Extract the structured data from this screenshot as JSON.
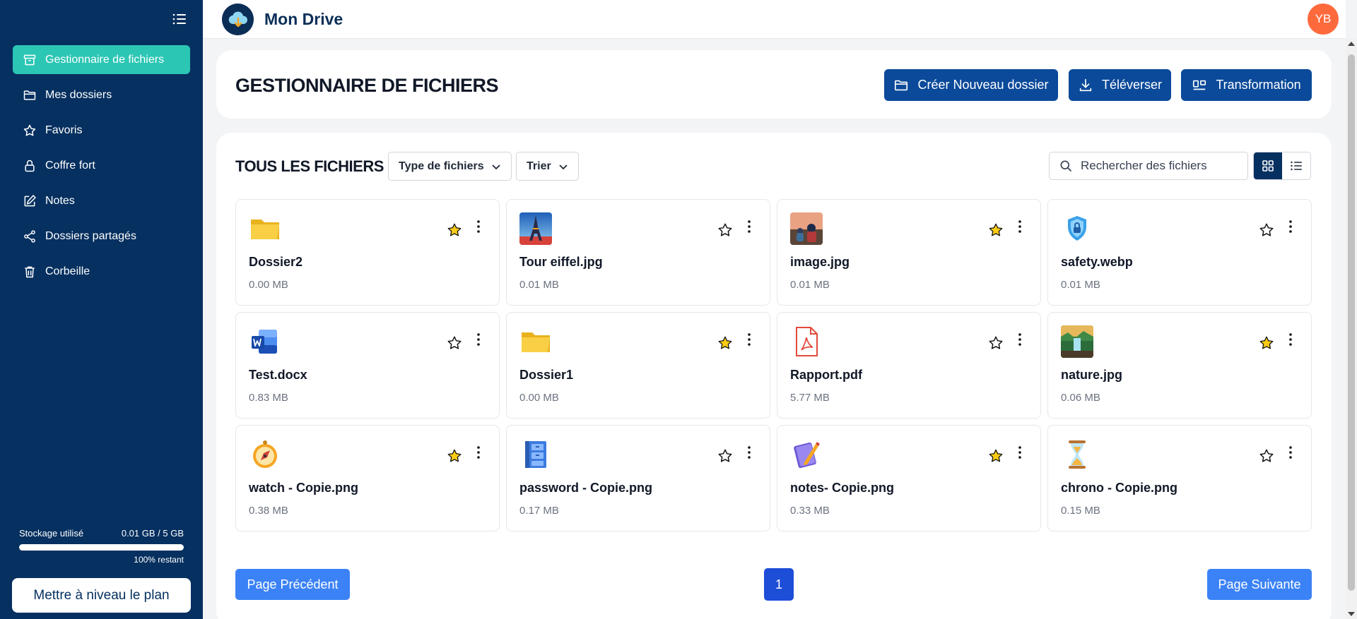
{
  "app": {
    "title": "Mon Drive",
    "avatar_initials": "YB"
  },
  "colors": {
    "sidebar_bg": "#063060",
    "active_item": "#2cc6b4",
    "primary_button": "#0b4a9a",
    "pager_button": "#3b82f6",
    "avatar": "#ff6a3d",
    "star_filled": "#facc15"
  },
  "sidebar": {
    "items": [
      {
        "label": "Gestionnaire de fichiers",
        "icon": "archive-icon",
        "active": true
      },
      {
        "label": "Mes dossiers",
        "icon": "folder-icon"
      },
      {
        "label": "Favoris",
        "icon": "star-icon"
      },
      {
        "label": "Coffre fort",
        "icon": "lock-icon"
      },
      {
        "label": "Notes",
        "icon": "edit-icon"
      },
      {
        "label": "Dossiers partagés",
        "icon": "share-icon"
      },
      {
        "label": "Corbeille",
        "icon": "trash-icon"
      }
    ],
    "storage": {
      "label": "Stockage utilisé",
      "value": "0.01 GB / 5 GB",
      "remaining": "100% restant",
      "used_fraction": 1.0
    },
    "upgrade_label": "Mettre à niveau le plan"
  },
  "header": {
    "title": "GESTIONNAIRE DE FICHIERS",
    "buttons": {
      "new_folder": "Créer Nouveau dossier",
      "upload": "Téléverser",
      "transform": "Transformation"
    }
  },
  "main": {
    "title": "TOUS LES FICHIERS",
    "filter_label": "Type de fichiers",
    "sort_label": "Trier",
    "search_placeholder": "Rechercher des fichiers",
    "files": [
      {
        "name": "Dossier2",
        "size": "0.00 MB",
        "icon": "folder-icon",
        "starred": true
      },
      {
        "name": "Tour eiffel.jpg",
        "size": "0.01 MB",
        "icon": "eiffel-image-icon",
        "starred": false
      },
      {
        "name": "image.jpg",
        "size": "0.01 MB",
        "icon": "photo-image-icon",
        "starred": true
      },
      {
        "name": "safety.webp",
        "size": "0.01 MB",
        "icon": "shield-icon",
        "starred": false
      },
      {
        "name": "Test.docx",
        "size": "0.83 MB",
        "icon": "word-icon",
        "starred": false
      },
      {
        "name": "Dossier1",
        "size": "0.00 MB",
        "icon": "folder-icon",
        "starred": true
      },
      {
        "name": "Rapport.pdf",
        "size": "5.77 MB",
        "icon": "pdf-icon",
        "starred": false
      },
      {
        "name": "nature.jpg",
        "size": "0.06 MB",
        "icon": "nature-image-icon",
        "starred": true
      },
      {
        "name": "watch - Copie.png",
        "size": "0.38 MB",
        "icon": "compass-icon",
        "starred": true
      },
      {
        "name": "password - Copie.png",
        "size": "0.17 MB",
        "icon": "cabinet-icon",
        "starred": false
      },
      {
        "name": "notes- Copie.png",
        "size": "0.33 MB",
        "icon": "notebook-icon",
        "starred": true
      },
      {
        "name": "chrono - Copie.png",
        "size": "0.15 MB",
        "icon": "hourglass-icon",
        "starred": false
      }
    ],
    "pagination": {
      "prev": "Page Précédent",
      "current": "1",
      "next": "Page Suivante"
    }
  }
}
